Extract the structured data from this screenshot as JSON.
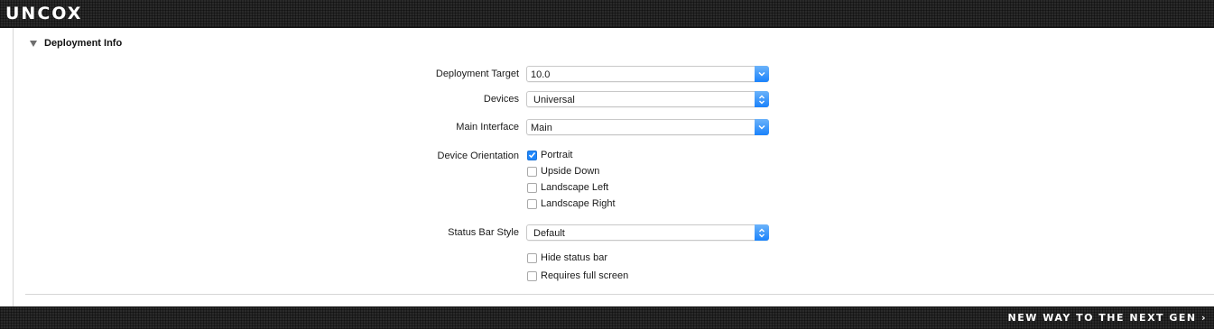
{
  "brand": {
    "logo": "UNCOX",
    "tagline": "NEW WAY TO THE NEXT GEN ›"
  },
  "section": {
    "title": "Deployment Info",
    "expanded": true
  },
  "fields": {
    "deployment_target": {
      "label": "Deployment Target",
      "value": "10.0"
    },
    "devices": {
      "label": "Devices",
      "value": "Universal"
    },
    "main_interface": {
      "label": "Main Interface",
      "value": "Main"
    },
    "status_bar_style": {
      "label": "Status Bar Style",
      "value": "Default"
    }
  },
  "orientation": {
    "label": "Device Orientation",
    "options": [
      {
        "label": "Portrait",
        "checked": true
      },
      {
        "label": "Upside Down",
        "checked": false
      },
      {
        "label": "Landscape Left",
        "checked": false
      },
      {
        "label": "Landscape Right",
        "checked": false
      }
    ]
  },
  "status_bar": {
    "options": [
      {
        "label": "Hide status bar",
        "checked": false
      },
      {
        "label": "Requires full screen",
        "checked": false
      }
    ]
  },
  "colors": {
    "accent": "#1e86fb",
    "bar": "#2a2a2a"
  }
}
